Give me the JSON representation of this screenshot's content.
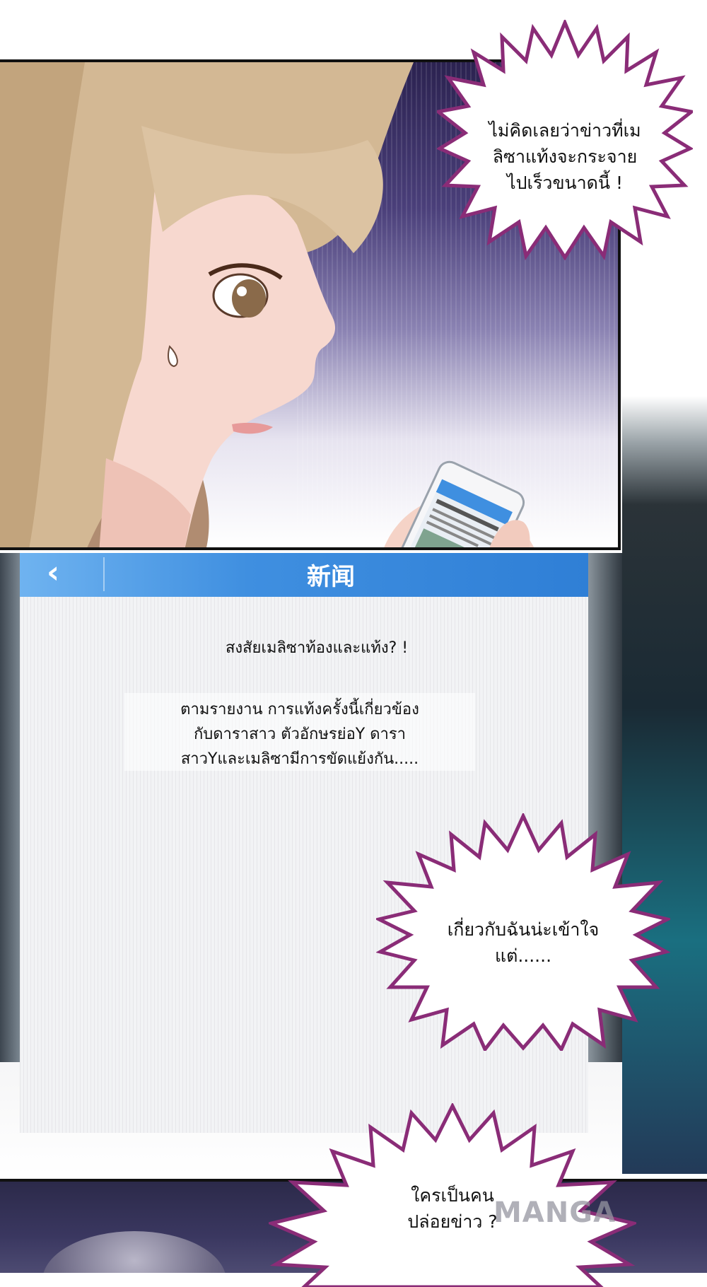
{
  "panels": {
    "top": {
      "bubble": [
        "ไม่คิดเลยว่าข่าวที่เม",
        "ลิซาแท้งจะกระจาย",
        "ไปเร็วขนาดนี้ !"
      ]
    },
    "phone": {
      "header_title": "新闻",
      "headline": "สงสัยเมลิซาท้องและแท้ง? !",
      "body_lines": [
        "ตามรายงาน การแท้งครั้งนี้เกี่ยวข้อง",
        "กับดาราสาว ตัวอักษรย่อY ดารา",
        "สาวYและเมลิซามีการขัดแย้งกัน....."
      ],
      "bubble": [
        "เกี่ยวกับฉันน่ะเข้าใจ",
        "แต่......"
      ]
    },
    "bottom": {
      "bubble": [
        "ใครเป็นคน",
        "ปล่อยข่าว ?"
      ]
    }
  },
  "watermark": "MANGA",
  "icons": {
    "back": "chevron-left-icon"
  },
  "colors": {
    "bubble_outline": "#8a2c77",
    "news_header": "#3f8fe0"
  }
}
